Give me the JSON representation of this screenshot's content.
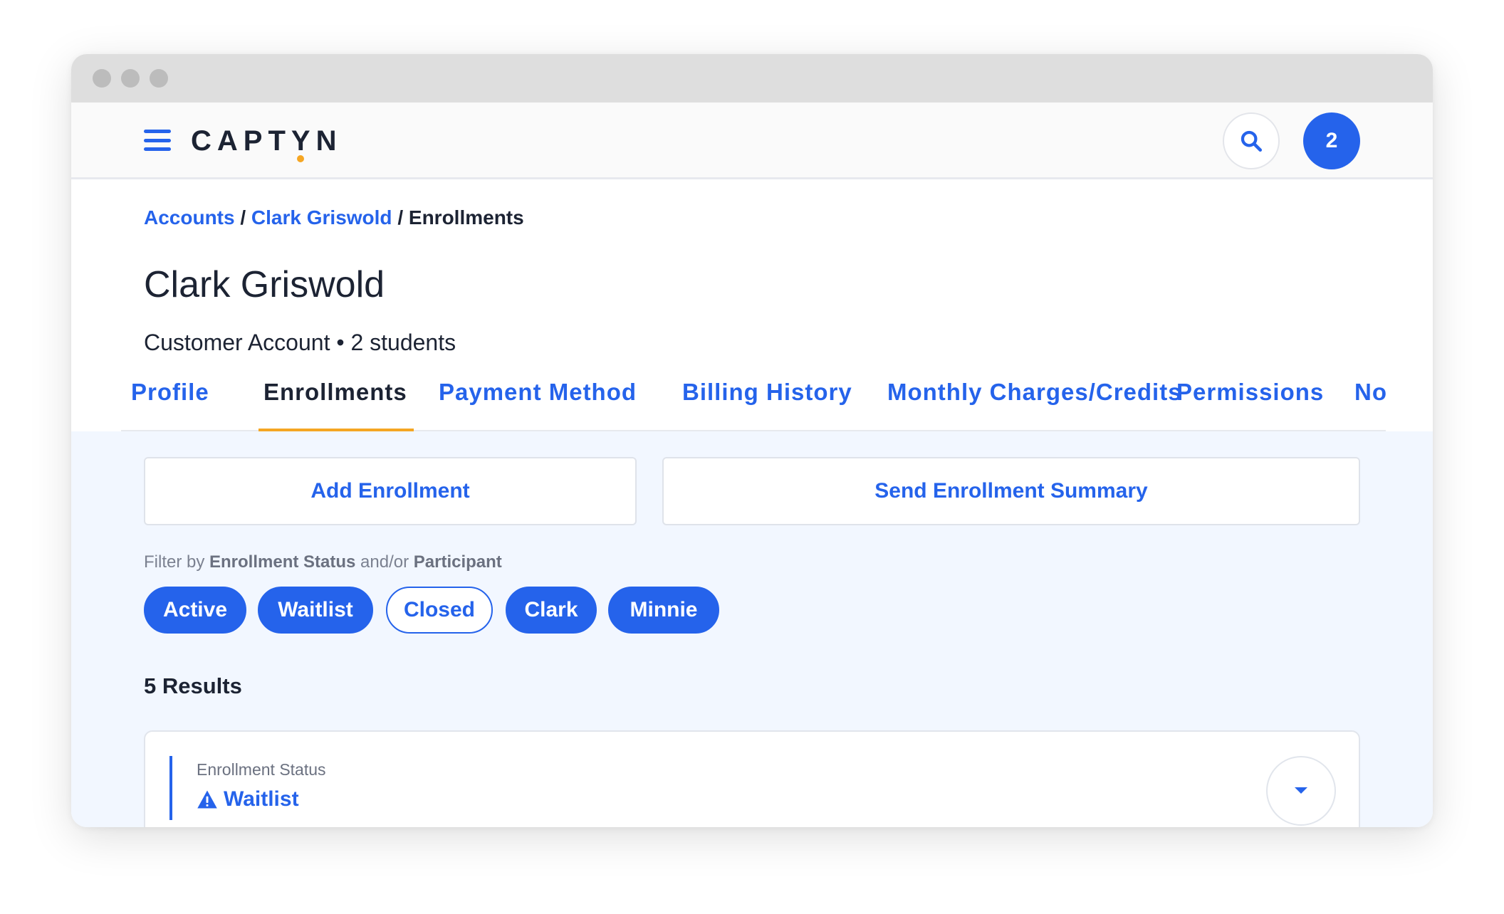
{
  "app": {
    "logo_text": "CAPTYN",
    "notification_count": "2"
  },
  "breadcrumb": {
    "items": [
      "Accounts",
      "Clark Griswold"
    ],
    "separator": " / ",
    "current": "Enrollments"
  },
  "account": {
    "name": "Clark Griswold",
    "subtitle": "Customer Account • 2 students"
  },
  "tabs": [
    {
      "label": "Profile",
      "active": false
    },
    {
      "label": "Enrollments",
      "active": true
    },
    {
      "label": "Payment Method",
      "active": false
    },
    {
      "label": "Billing History",
      "active": false
    },
    {
      "label": "Monthly Charges/Credits",
      "active": false
    },
    {
      "label": "Permissions",
      "active": false
    },
    {
      "label": "No",
      "active": false
    }
  ],
  "actions": {
    "add_enrollment": "Add Enrollment",
    "send_summary": "Send Enrollment Summary"
  },
  "filter": {
    "prefix": "Filter by ",
    "field1": "Enrollment Status",
    "joiner": " and/or ",
    "field2": "Participant",
    "chips": [
      {
        "label": "Active",
        "selected": true
      },
      {
        "label": "Waitlist",
        "selected": true
      },
      {
        "label": "Closed",
        "selected": false
      },
      {
        "label": "Clark",
        "selected": true
      },
      {
        "label": "Minnie",
        "selected": true
      }
    ]
  },
  "results": {
    "count_label": "5 Results"
  },
  "enrollment_card": {
    "status_label": "Enrollment Status",
    "status_value": "Waitlist",
    "status_icon": "warning-icon"
  },
  "colors": {
    "accent": "#2563eb",
    "tab_indicator": "#f5a623",
    "content_bg": "#f2f7ff"
  }
}
